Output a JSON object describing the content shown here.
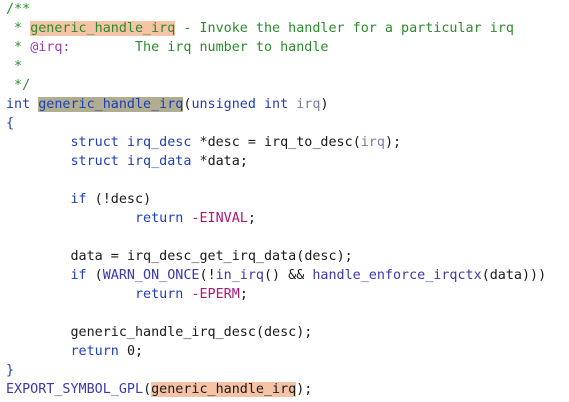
{
  "lines": [
    {
      "tokens": [
        {
          "t": "/**",
          "c": "comment"
        }
      ]
    },
    {
      "tokens": [
        {
          "t": " * ",
          "c": "comment"
        },
        {
          "t": "generic_handle_irq",
          "c": "comment hl-comment"
        },
        {
          "t": " - Invoke the handler for a particular irq",
          "c": "comment"
        }
      ]
    },
    {
      "tokens": [
        {
          "t": " * ",
          "c": "comment"
        },
        {
          "t": "@irq:",
          "c": "doctag"
        },
        {
          "t": "        The irq number to handle",
          "c": "comment"
        }
      ]
    },
    {
      "tokens": [
        {
          "t": " *",
          "c": "comment"
        }
      ]
    },
    {
      "tokens": [
        {
          "t": " */",
          "c": "comment"
        }
      ]
    },
    {
      "tokens": [
        {
          "t": "int",
          "c": "kw"
        },
        {
          "t": " ",
          "c": "plain"
        },
        {
          "t": "generic_handle_irq",
          "c": "id hl-def"
        },
        {
          "t": "(",
          "c": "paren"
        },
        {
          "t": "unsigned int",
          "c": "kw"
        },
        {
          "t": " ",
          "c": "plain"
        },
        {
          "t": "irq",
          "c": "muted"
        },
        {
          "t": ")",
          "c": "paren"
        }
      ]
    },
    {
      "tokens": [
        {
          "t": "{",
          "c": "kw"
        }
      ]
    },
    {
      "tokens": [
        {
          "t": "        ",
          "c": "plain"
        },
        {
          "t": "struct",
          "c": "kw"
        },
        {
          "t": " ",
          "c": "plain"
        },
        {
          "t": "irq_desc",
          "c": "id"
        },
        {
          "t": " *",
          "c": "plain"
        },
        {
          "t": "desc",
          "c": "plain"
        },
        {
          "t": " = ",
          "c": "plain"
        },
        {
          "t": "irq_to_desc",
          "c": "plain"
        },
        {
          "t": "(",
          "c": "paren"
        },
        {
          "t": "irq",
          "c": "muted"
        },
        {
          "t": ");",
          "c": "plain"
        }
      ]
    },
    {
      "tokens": [
        {
          "t": "        ",
          "c": "plain"
        },
        {
          "t": "struct",
          "c": "kw"
        },
        {
          "t": " ",
          "c": "plain"
        },
        {
          "t": "irq_data",
          "c": "id"
        },
        {
          "t": " *",
          "c": "plain"
        },
        {
          "t": "data",
          "c": "plain"
        },
        {
          "t": ";",
          "c": "plain"
        }
      ]
    },
    {
      "tokens": []
    },
    {
      "tokens": [
        {
          "t": "        ",
          "c": "plain"
        },
        {
          "t": "if",
          "c": "kw"
        },
        {
          "t": " (",
          "c": "plain"
        },
        {
          "t": "!desc",
          "c": "plain"
        },
        {
          "t": ")",
          "c": "plain"
        }
      ]
    },
    {
      "tokens": [
        {
          "t": "                ",
          "c": "plain"
        },
        {
          "t": "return",
          "c": "kw"
        },
        {
          "t": " ",
          "c": "plain"
        },
        {
          "t": "-EINVAL",
          "c": "neg"
        },
        {
          "t": ";",
          "c": "plain"
        }
      ]
    },
    {
      "tokens": []
    },
    {
      "tokens": [
        {
          "t": "        ",
          "c": "plain"
        },
        {
          "t": "data",
          "c": "plain"
        },
        {
          "t": " = ",
          "c": "plain"
        },
        {
          "t": "irq_desc_get_irq_data",
          "c": "plain"
        },
        {
          "t": "(",
          "c": "paren"
        },
        {
          "t": "desc",
          "c": "plain"
        },
        {
          "t": ");",
          "c": "plain"
        }
      ]
    },
    {
      "tokens": [
        {
          "t": "        ",
          "c": "plain"
        },
        {
          "t": "if",
          "c": "kw"
        },
        {
          "t": " (",
          "c": "plain"
        },
        {
          "t": "WARN_ON_ONCE",
          "c": "macro"
        },
        {
          "t": "(",
          "c": "paren"
        },
        {
          "t": "!",
          "c": "plain"
        },
        {
          "t": "in_irq",
          "c": "macro"
        },
        {
          "t": "() && ",
          "c": "plain"
        },
        {
          "t": "handle_enforce_irqctx",
          "c": "macro"
        },
        {
          "t": "(",
          "c": "paren"
        },
        {
          "t": "data",
          "c": "plain"
        },
        {
          "t": ")))",
          "c": "plain"
        }
      ]
    },
    {
      "tokens": [
        {
          "t": "                ",
          "c": "plain"
        },
        {
          "t": "return",
          "c": "kw"
        },
        {
          "t": " ",
          "c": "plain"
        },
        {
          "t": "-EPERM",
          "c": "neg"
        },
        {
          "t": ";",
          "c": "plain"
        }
      ]
    },
    {
      "tokens": []
    },
    {
      "tokens": [
        {
          "t": "        ",
          "c": "plain"
        },
        {
          "t": "generic_handle_irq_desc",
          "c": "plain"
        },
        {
          "t": "(",
          "c": "paren"
        },
        {
          "t": "desc",
          "c": "plain"
        },
        {
          "t": ");",
          "c": "plain"
        }
      ]
    },
    {
      "tokens": [
        {
          "t": "        ",
          "c": "plain"
        },
        {
          "t": "return",
          "c": "kw"
        },
        {
          "t": " ",
          "c": "plain"
        },
        {
          "t": "0",
          "c": "num"
        },
        {
          "t": ";",
          "c": "plain"
        }
      ]
    },
    {
      "tokens": [
        {
          "t": "}",
          "c": "kw"
        }
      ]
    },
    {
      "tokens": [
        {
          "t": "EXPORT_SYMBOL_GPL",
          "c": "macro"
        },
        {
          "t": "(",
          "c": "paren"
        },
        {
          "t": "generic_handle_irq",
          "c": "plain hl-export"
        },
        {
          "t": ");",
          "c": "plain"
        }
      ]
    }
  ]
}
